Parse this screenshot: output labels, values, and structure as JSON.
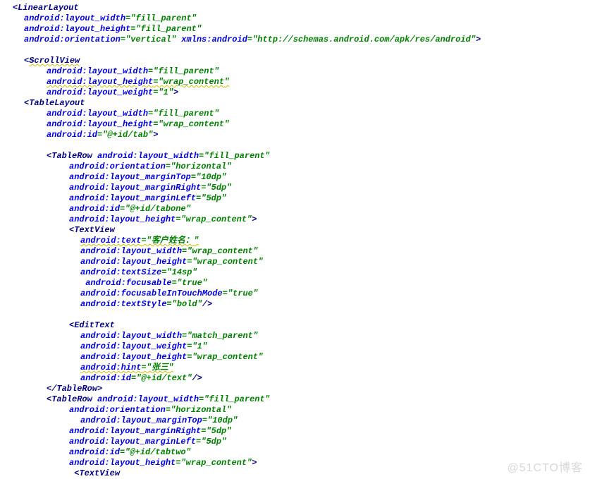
{
  "watermark": "@51CTO博客",
  "root": {
    "tag": "LinearLayout",
    "lw": "fill_parent",
    "lh": "fill_parent",
    "orient": "vertical",
    "xmlns": "http://schemas.android.com/apk/res/android"
  },
  "sv": {
    "tag": "ScrollView",
    "lw": "fill_parent",
    "lh": "wrap_content",
    "w": "1"
  },
  "tl": {
    "tag": "TableLayout",
    "lw": "fill_parent",
    "lh": "wrap_content",
    "id": "@+id/tab"
  },
  "r1": {
    "tag": "TableRow",
    "lw": "fill_parent",
    "orient": "horizontal",
    "mt": "10dp",
    "mr": "5dp",
    "ml": "5dp",
    "id": "@+id/tabone",
    "lh": "wrap_content"
  },
  "tv1": {
    "tag": "TextView",
    "text": "客户姓名：",
    "lw": "wrap_content",
    "lh": "wrap_content",
    "ts": "14sp",
    "foc": "true",
    "focT": "true",
    "style": "bold"
  },
  "et1": {
    "tag": "EditText",
    "lw": "match_parent",
    "w": "1",
    "lh": "wrap_content",
    "hint": "张三",
    "id": "@+id/text"
  },
  "r1close": "TableRow",
  "r2": {
    "tag": "TableRow",
    "lw": "fill_parent",
    "orient": "horizontal",
    "mt": "10dp",
    "mr": "5dp",
    "ml": "5dp",
    "id": "@+id/tabtwo",
    "lh": "wrap_content"
  },
  "tv2": {
    "tag": "TextView"
  }
}
